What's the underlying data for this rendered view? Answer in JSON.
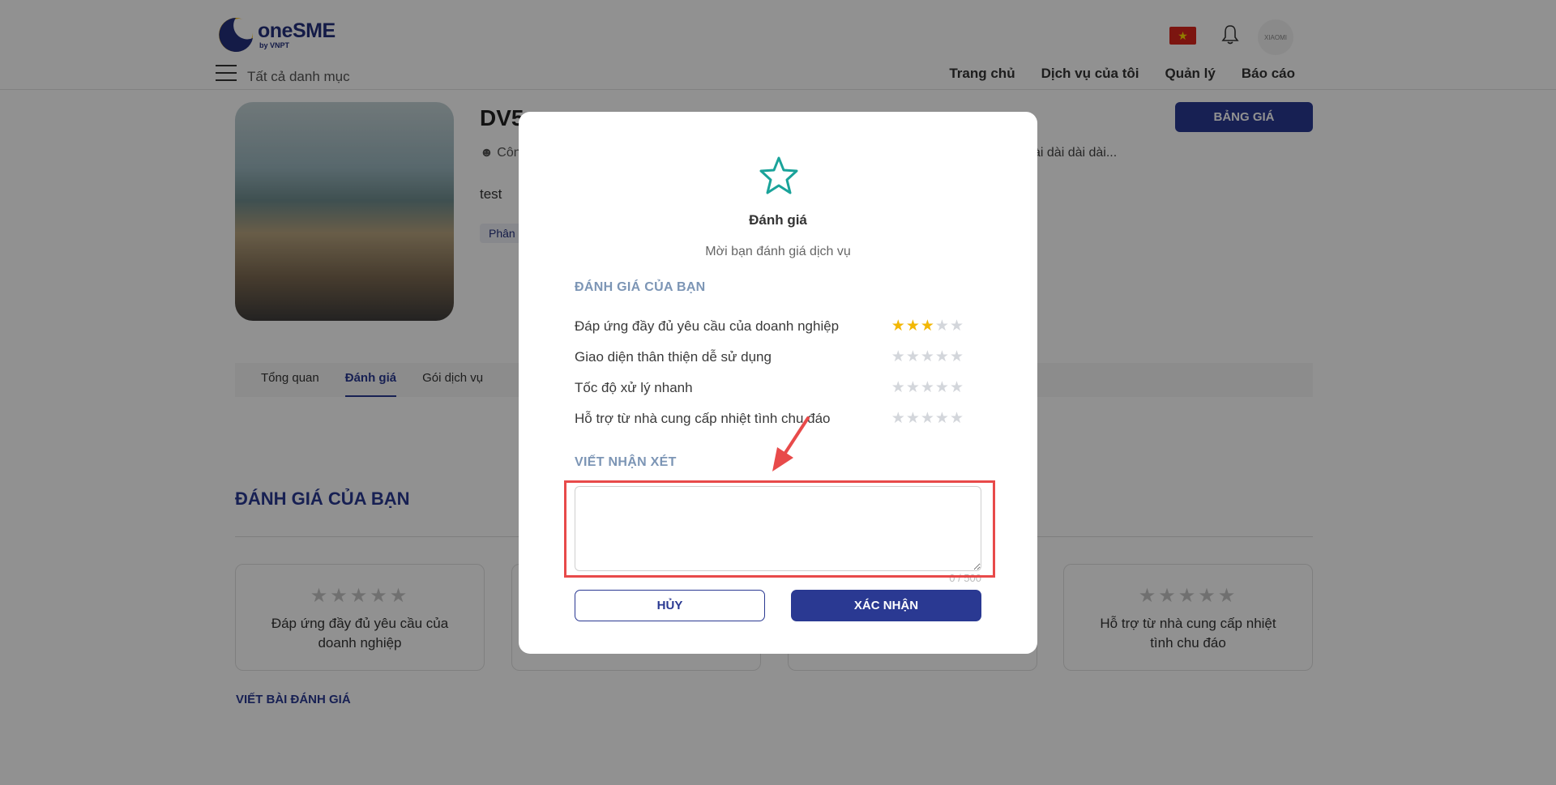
{
  "header": {
    "logo_name": "oneSME",
    "logo_sub": "by VNPT",
    "all_categories": "Tất cả danh mục",
    "nav": [
      "Trang chủ",
      "Dịch vụ của tôi",
      "Quản lý",
      "Báo cáo"
    ],
    "flag": "vietnam-flag",
    "avatar_text": "XIAOMI"
  },
  "product": {
    "title": "DV5",
    "meta": "Côn",
    "desc": "test",
    "tag": "Phân",
    "long_text": "ài dài dài dài...",
    "price_button": "BẢNG GIÁ"
  },
  "tabs": [
    {
      "label": "Tổng quan",
      "active": false
    },
    {
      "label": "Đánh giá",
      "active": true
    },
    {
      "label": "Gói dịch vụ",
      "active": false
    }
  ],
  "page_section": {
    "title": "ĐÁNH GIÁ CỦA BẠN",
    "cards": [
      {
        "label": "Đáp ứng đầy đủ yêu cầu của doanh nghiệp"
      },
      {
        "label": "Hỗ trợ từ nhà cung cấp nhiệt tình chu đáo"
      }
    ],
    "write_review": "VIẾT BÀI ĐÁNH GIÁ"
  },
  "modal": {
    "title": "Đánh giá",
    "subtitle": "Mời bạn đánh giá dịch vụ",
    "rating_heading": "ĐÁNH GIÁ CỦA BẠN",
    "criteria": [
      {
        "label": "Đáp ứng đầy đủ yêu cầu của doanh nghiệp",
        "rating": 3
      },
      {
        "label": "Giao diện thân thiện dễ sử dụng",
        "rating": 0
      },
      {
        "label": "Tốc độ xử lý nhanh",
        "rating": 0
      },
      {
        "label": "Hỗ trợ từ nhà cung cấp nhiệt tình chu đáo",
        "rating": 0
      }
    ],
    "max_rating": 5,
    "comment_heading": "VIẾT NHẬN XÉT",
    "comment_value": "",
    "counter": "0 / 500",
    "cancel": "HỦY",
    "confirm": "XÁC NHẬN"
  },
  "colors": {
    "brand": "#2a3992",
    "star_on": "#f2b705",
    "star_off": "#d3d6db",
    "star_icon": "#1aa39a",
    "annotation": "#e84a4a"
  }
}
